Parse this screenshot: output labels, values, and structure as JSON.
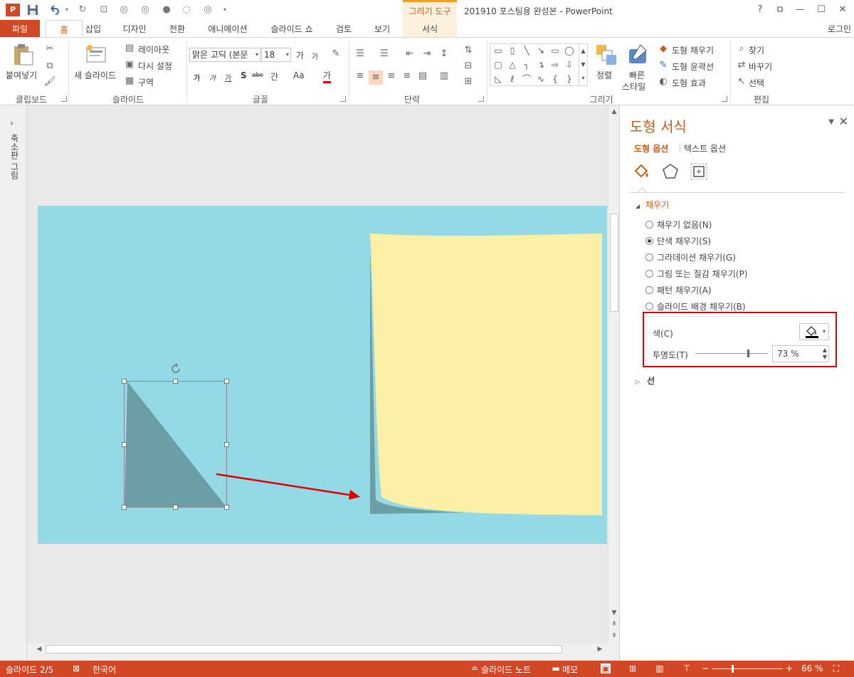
{
  "window": {
    "title": "201910 포스팅용 완성본 - PowerPoint",
    "contextual_tab_group": "그리기 도구",
    "help": "?",
    "restore_ribbon": "⧉",
    "minimize": "—",
    "maximize": "☐",
    "close": "✕",
    "app_logo": "P"
  },
  "quick_access": {
    "save_icon": "save-icon",
    "undo_icon": "undo-icon",
    "redo_icon": "redo-icon"
  },
  "tabs": [
    {
      "label": "파일"
    },
    {
      "label": "홈"
    },
    {
      "label": "삽입"
    },
    {
      "label": "디자인"
    },
    {
      "label": "전환"
    },
    {
      "label": "애니메이션"
    },
    {
      "label": "슬라이드 쇼"
    },
    {
      "label": "검토"
    },
    {
      "label": "보기"
    },
    {
      "label": "서식"
    }
  ],
  "signin": "로그인",
  "ribbon": {
    "clipboard": {
      "paste": "붙여넣기",
      "label": "클립보드"
    },
    "slides": {
      "new_slide": "새 슬라이드",
      "layout": "레이아웃",
      "reset": "다시 설정",
      "section": "구역",
      "label": "슬라이드"
    },
    "font": {
      "font_name": "맑은 고딕 (본문",
      "font_size": "18",
      "grow": "가",
      "shrink": "가",
      "bold": "가",
      "italic": "가",
      "underline": "가",
      "shadow": "S",
      "strike": "abc",
      "spacing": "간",
      "case": "Aa",
      "color": "가",
      "label": "글꼴"
    },
    "paragraph": {
      "label": "단락"
    },
    "drawing": {
      "arrange": "정렬",
      "quick_styles_1": "빠른",
      "quick_styles_2": "스타일",
      "fill": "도형 채우기",
      "outline": "도형 윤곽선",
      "effects": "도형 효과",
      "label": "그리기"
    },
    "editing": {
      "find": "찾기",
      "replace": "바꾸기",
      "select": "선택",
      "label": "편집"
    }
  },
  "thumbnail_pane": {
    "toggle": "›",
    "label": "축소판 그림"
  },
  "format_pane": {
    "title": "도형 서식",
    "tab_shape": "도형 옵션",
    "tab_text": "텍스트 옵션",
    "fill_section": "채우기",
    "fill_options": [
      {
        "label": "채우기 없음(N)",
        "selected": false
      },
      {
        "label": "단색 채우기(S)",
        "selected": true
      },
      {
        "label": "그라데이션 채우기(G)",
        "selected": false
      },
      {
        "label": "그림 또는 질감 채우기(P)",
        "selected": false
      },
      {
        "label": "패턴 채우기(A)",
        "selected": false
      },
      {
        "label": "슬라이드 배경 채우기(B)",
        "selected": false
      }
    ],
    "color_label": "색(C)",
    "transparency_label": "투명도(T)",
    "transparency_value": "73 %",
    "transparency_level": 0.73,
    "line_section": "선"
  },
  "slide": {
    "background_color": "#93d9e6",
    "note_color": "#fbf0a6",
    "shadow_color": "#6b9ea5",
    "annotation_color": "#e00000"
  },
  "statusbar": {
    "slide_info": "슬라이드 2/5",
    "language": "한국어",
    "notes": "슬라이드 노트",
    "comments": "메모",
    "zoom": "66 %",
    "zoom_minus": "−",
    "zoom_plus": "+"
  }
}
